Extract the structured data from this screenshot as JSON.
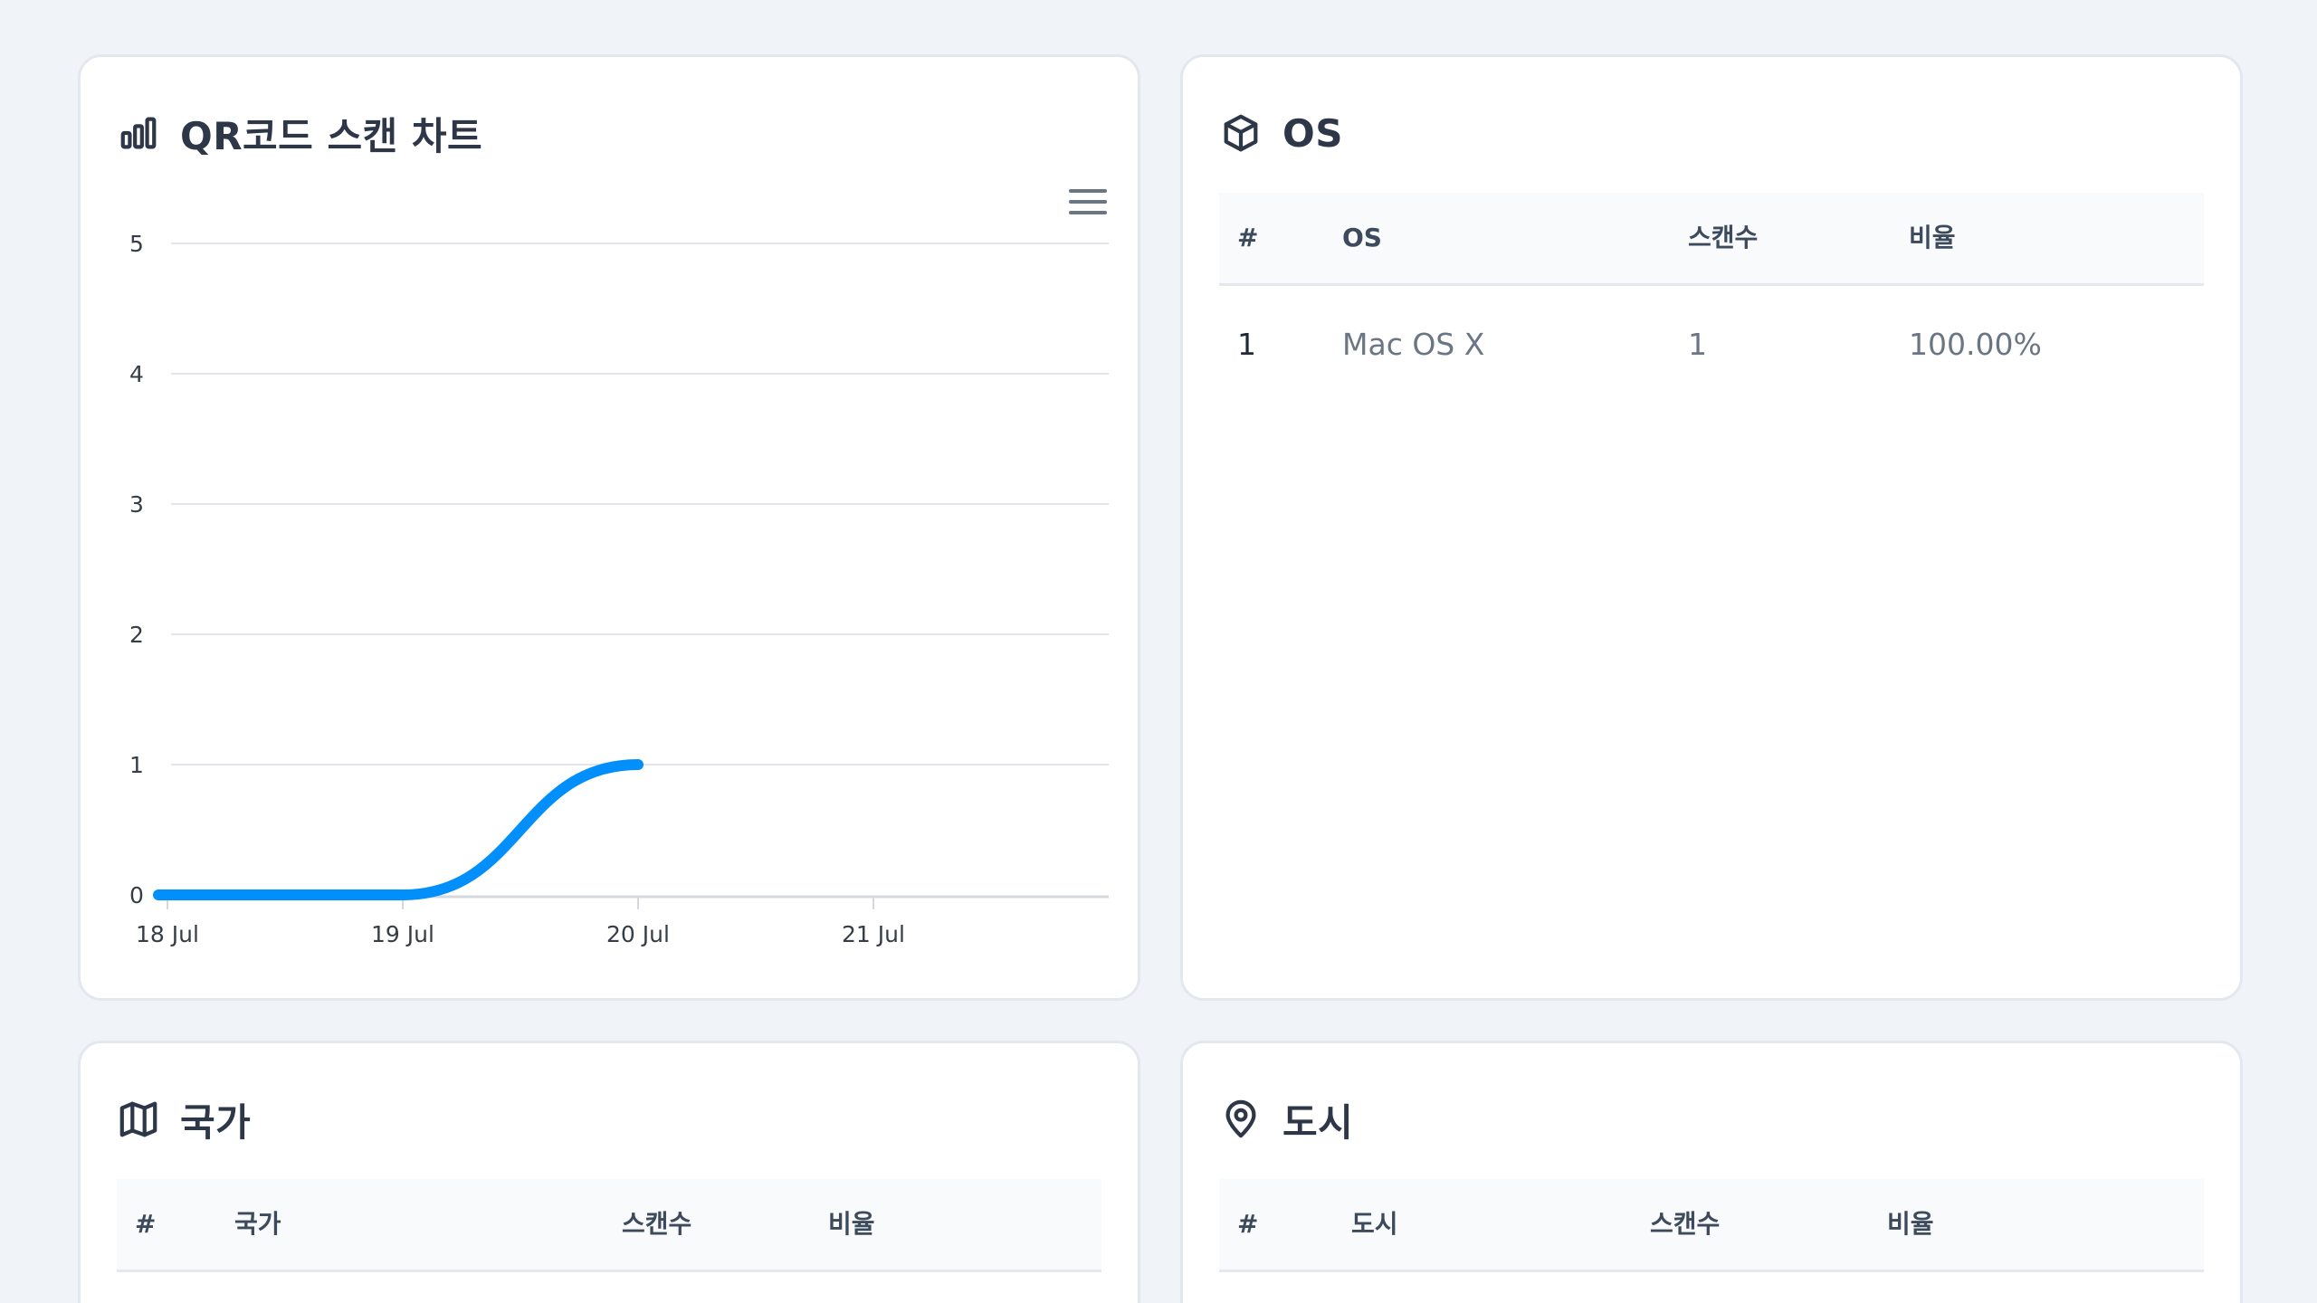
{
  "chart_card": {
    "title": "QR코드 스캔 차트",
    "icon": "bar-chart-icon"
  },
  "chart_data": {
    "type": "line",
    "x": [
      "18 Jul",
      "19 Jul",
      "20 Jul"
    ],
    "series": [
      {
        "values": [
          0,
          0,
          1
        ]
      }
    ],
    "xticks": [
      "18 Jul",
      "19 Jul",
      "20 Jul",
      "21 Jul"
    ],
    "yticks": [
      "0",
      "1",
      "2",
      "3",
      "4",
      "5"
    ],
    "ylim": [
      0,
      5
    ],
    "grid": true,
    "line_color": "#008ffb"
  },
  "os_card": {
    "title": "OS",
    "icon": "cube-icon",
    "columns": [
      "#",
      "OS",
      "스캔수",
      "비율"
    ],
    "rows": [
      {
        "idx": "1",
        "name": "Mac OS X",
        "scans": "1",
        "ratio": "100.00%"
      }
    ]
  },
  "country_card": {
    "title": "국가",
    "icon": "map-icon",
    "columns": [
      "#",
      "국가",
      "스캔수",
      "비율"
    ]
  },
  "city_card": {
    "title": "도시",
    "icon": "map-pin-icon",
    "columns": [
      "#",
      "도시",
      "스캔수",
      "비율"
    ]
  }
}
